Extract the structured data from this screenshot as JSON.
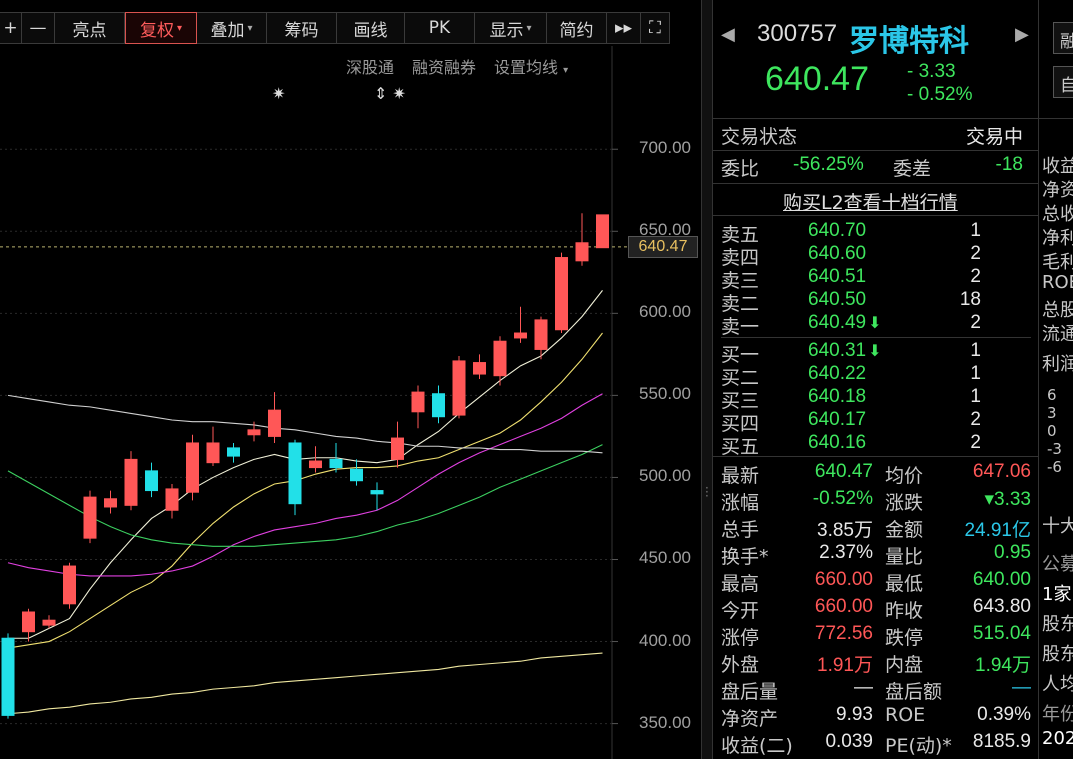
{
  "toolbar": {
    "buttons": [
      {
        "label": "+",
        "caret": false,
        "active": false
      },
      {
        "label": "—",
        "caret": false,
        "active": false
      },
      {
        "label": "亮点",
        "caret": false,
        "active": false
      },
      {
        "label": "复权",
        "caret": true,
        "active": true
      },
      {
        "label": "叠加",
        "caret": true,
        "active": false
      },
      {
        "label": "筹码",
        "caret": false,
        "active": false
      },
      {
        "label": "画线",
        "caret": false,
        "active": false
      },
      {
        "label": "PK",
        "caret": false,
        "active": false
      },
      {
        "label": "显示",
        "caret": true,
        "active": false
      },
      {
        "label": "简约",
        "caret": false,
        "active": false
      },
      {
        "label": "▸▸",
        "caret": false,
        "active": false
      },
      {
        "label": "⛶",
        "caret": false,
        "active": false
      }
    ]
  },
  "chart_links": {
    "shenggutong": "深股通",
    "margin": "融资融券",
    "ma_settings": "设置均线"
  },
  "chart_data": {
    "type": "candlestick",
    "ylim": [
      340,
      730
    ],
    "y_ticks": [
      "700.00",
      "650.00",
      "600.00",
      "550.00",
      "500.00",
      "450.00",
      "400.00",
      "350.00"
    ],
    "last_price_label": "640.47",
    "candles": [
      {
        "o": 402,
        "c": 355,
        "h": 405,
        "l": 353
      },
      {
        "o": 406,
        "c": 418,
        "h": 420,
        "l": 400
      },
      {
        "o": 410,
        "c": 413,
        "h": 416,
        "l": 408
      },
      {
        "o": 423,
        "c": 446,
        "h": 448,
        "l": 420
      },
      {
        "o": 463,
        "c": 488,
        "h": 492,
        "l": 460
      },
      {
        "o": 482,
        "c": 487,
        "h": 492,
        "l": 478
      },
      {
        "o": 483,
        "c": 511,
        "h": 516,
        "l": 480
      },
      {
        "o": 504,
        "c": 492,
        "h": 509,
        "l": 488
      },
      {
        "o": 480,
        "c": 493,
        "h": 496,
        "l": 475
      },
      {
        "o": 491,
        "c": 521,
        "h": 526,
        "l": 486
      },
      {
        "o": 509,
        "c": 521,
        "h": 531,
        "l": 507
      },
      {
        "o": 518,
        "c": 513,
        "h": 521,
        "l": 509
      },
      {
        "o": 526,
        "c": 529,
        "h": 534,
        "l": 522
      },
      {
        "o": 525,
        "c": 541,
        "h": 552,
        "l": 521
      },
      {
        "o": 521,
        "c": 484,
        "h": 523,
        "l": 477
      },
      {
        "o": 506,
        "c": 510,
        "h": 519,
        "l": 503
      },
      {
        "o": 511,
        "c": 506,
        "h": 521,
        "l": 503
      },
      {
        "o": 505,
        "c": 498,
        "h": 511,
        "l": 495
      },
      {
        "o": 492,
        "c": 490,
        "h": 497,
        "l": 480
      },
      {
        "o": 511,
        "c": 524,
        "h": 534,
        "l": 506
      },
      {
        "o": 540,
        "c": 552,
        "h": 556,
        "l": 530
      },
      {
        "o": 551,
        "c": 537,
        "h": 556,
        "l": 533
      },
      {
        "o": 538,
        "c": 571,
        "h": 574,
        "l": 536
      },
      {
        "o": 563,
        "c": 570,
        "h": 575,
        "l": 560
      },
      {
        "o": 562,
        "c": 583,
        "h": 586,
        "l": 556
      },
      {
        "o": 585,
        "c": 588,
        "h": 604,
        "l": 582
      },
      {
        "o": 578,
        "c": 596,
        "h": 598,
        "l": 572
      },
      {
        "o": 590,
        "c": 634,
        "h": 637,
        "l": 588
      },
      {
        "o": 632,
        "c": 643,
        "h": 661,
        "l": 629
      },
      {
        "o": 640,
        "c": 660,
        "h": 660,
        "l": 640
      }
    ],
    "ma": [
      {
        "color": "#f0f0d8",
        "values": [
          402,
          402,
          408,
          414,
          432,
          448,
          462,
          475,
          483,
          493,
          500,
          506,
          511,
          514,
          511,
          512,
          512,
          510,
          509,
          511,
          520,
          528,
          539,
          549,
          559,
          568,
          574,
          585,
          598,
          614
        ]
      },
      {
        "color": "#f0e070",
        "values": [
          396,
          398,
          400,
          406,
          414,
          422,
          430,
          436,
          446,
          460,
          472,
          482,
          490,
          496,
          498,
          502,
          505,
          506,
          506,
          507,
          510,
          512,
          517,
          522,
          527,
          535,
          546,
          558,
          572,
          588
        ]
      },
      {
        "color": "#e040e0",
        "values": [
          448,
          445,
          443,
          441,
          440,
          440,
          440,
          441,
          443,
          446,
          452,
          459,
          464,
          468,
          470,
          472,
          475,
          477,
          480,
          486,
          494,
          502,
          509,
          515,
          520,
          525,
          530,
          536,
          544,
          551
        ]
      },
      {
        "color": "#3cd060",
        "values": [
          504,
          497,
          490,
          483,
          476,
          470,
          465,
          462,
          460,
          459,
          458,
          458,
          458,
          459,
          460,
          461,
          462,
          464,
          467,
          471,
          474,
          478,
          483,
          488,
          494,
          499,
          504,
          509,
          514,
          520
        ]
      },
      {
        "color": "#d0d0d0",
        "values": [
          550,
          548,
          546,
          544,
          543,
          541,
          539,
          537,
          535,
          534,
          534,
          533,
          532,
          530,
          529,
          527,
          525,
          524,
          522,
          521,
          519,
          519,
          518,
          518,
          517,
          517,
          516,
          516,
          516,
          515
        ]
      },
      {
        "color": "#f0e8a0",
        "values": [
          356,
          357,
          359,
          360,
          362,
          363,
          365,
          366,
          368,
          369,
          371,
          372,
          373,
          375,
          376,
          377,
          378,
          379,
          380,
          381,
          382,
          383,
          385,
          386,
          387,
          388,
          390,
          391,
          392,
          393
        ]
      }
    ],
    "markers": [
      "✷",
      "⇕ ✷"
    ]
  },
  "stock": {
    "code": "300757",
    "name": "罗博特科",
    "price": "640.47",
    "change": "- 3.33",
    "change_pct": "- 0.52%"
  },
  "status": {
    "label": "交易状态",
    "value": "交易中"
  },
  "weibi": {
    "label": "委比",
    "value": "-56.25%",
    "label2": "委差",
    "value2": "-18"
  },
  "l2_link": "购买L2查看十档行情",
  "order_book": {
    "sells": [
      {
        "label": "卖五",
        "price": "640.70",
        "qty": "1",
        "arrow": ""
      },
      {
        "label": "卖四",
        "price": "640.60",
        "qty": "2",
        "arrow": ""
      },
      {
        "label": "卖三",
        "price": "640.51",
        "qty": "2",
        "arrow": ""
      },
      {
        "label": "卖二",
        "price": "640.50",
        "qty": "18",
        "arrow": ""
      },
      {
        "label": "卖一",
        "price": "640.49",
        "qty": "2",
        "arrow": "⬇"
      }
    ],
    "buys": [
      {
        "label": "买一",
        "price": "640.31",
        "qty": "1",
        "arrow": "⬇"
      },
      {
        "label": "买二",
        "price": "640.22",
        "qty": "1",
        "arrow": ""
      },
      {
        "label": "买三",
        "price": "640.18",
        "qty": "1",
        "arrow": ""
      },
      {
        "label": "买四",
        "price": "640.17",
        "qty": "2",
        "arrow": ""
      },
      {
        "label": "买五",
        "price": "640.16",
        "qty": "2",
        "arrow": ""
      }
    ]
  },
  "quotes": [
    {
      "l1": "最新",
      "v1": "640.47",
      "c1": "green",
      "l2": "均价",
      "v2": "647.06",
      "c2": "red"
    },
    {
      "l1": "涨幅",
      "v1": "-0.52%",
      "c1": "green",
      "l2": "涨跌",
      "v2": "▾3.33",
      "c2": "green"
    },
    {
      "l1": "总手",
      "v1": "3.85万",
      "c1": "white",
      "l2": "金额",
      "v2": "24.91亿",
      "c2": "cyan"
    },
    {
      "l1": "换手*",
      "v1": "2.37%",
      "c1": "white",
      "l2": "量比",
      "v2": "0.95",
      "c2": "green"
    },
    {
      "l1": "最高",
      "v1": "660.00",
      "c1": "red",
      "l2": "最低",
      "v2": "640.00",
      "c2": "green"
    },
    {
      "l1": "今开",
      "v1": "660.00",
      "c1": "red",
      "l2": "昨收",
      "v2": "643.80",
      "c2": "white"
    },
    {
      "l1": "涨停",
      "v1": "772.56",
      "c1": "red",
      "l2": "跌停",
      "v2": "515.04",
      "c2": "green"
    },
    {
      "l1": "外盘",
      "v1": "1.91万",
      "c1": "red",
      "l2": "内盘",
      "v2": "1.94万",
      "c2": "green"
    },
    {
      "l1": "盘后量",
      "v1": "—",
      "c1": "white",
      "l2": "盘后额",
      "v2": "—",
      "c2": "cyan"
    },
    {
      "l1": "净资产",
      "v1": "9.93",
      "c1": "white",
      "l2": "ROE",
      "v2": "0.39%",
      "c2": "white"
    },
    {
      "l1": "收益(二)",
      "v1": "0.039",
      "c1": "white",
      "l2": "PE(动)*",
      "v2": "8185.9",
      "c2": "white"
    }
  ],
  "side_panel": {
    "btn1": "融",
    "btn2": "自",
    "labels": [
      "收益",
      "净资",
      "总收",
      "净利",
      "毛利",
      "ROE",
      "总股",
      "流通"
    ],
    "section1": "利润",
    "axis": [
      "6",
      "3",
      "0",
      "-3",
      "-6"
    ],
    "section2": "十大",
    "row1": "公募",
    "row2": "1家",
    "row3": "股东",
    "row4": "股东",
    "row5": "人均",
    "row6": "年份",
    "row7": "202"
  }
}
